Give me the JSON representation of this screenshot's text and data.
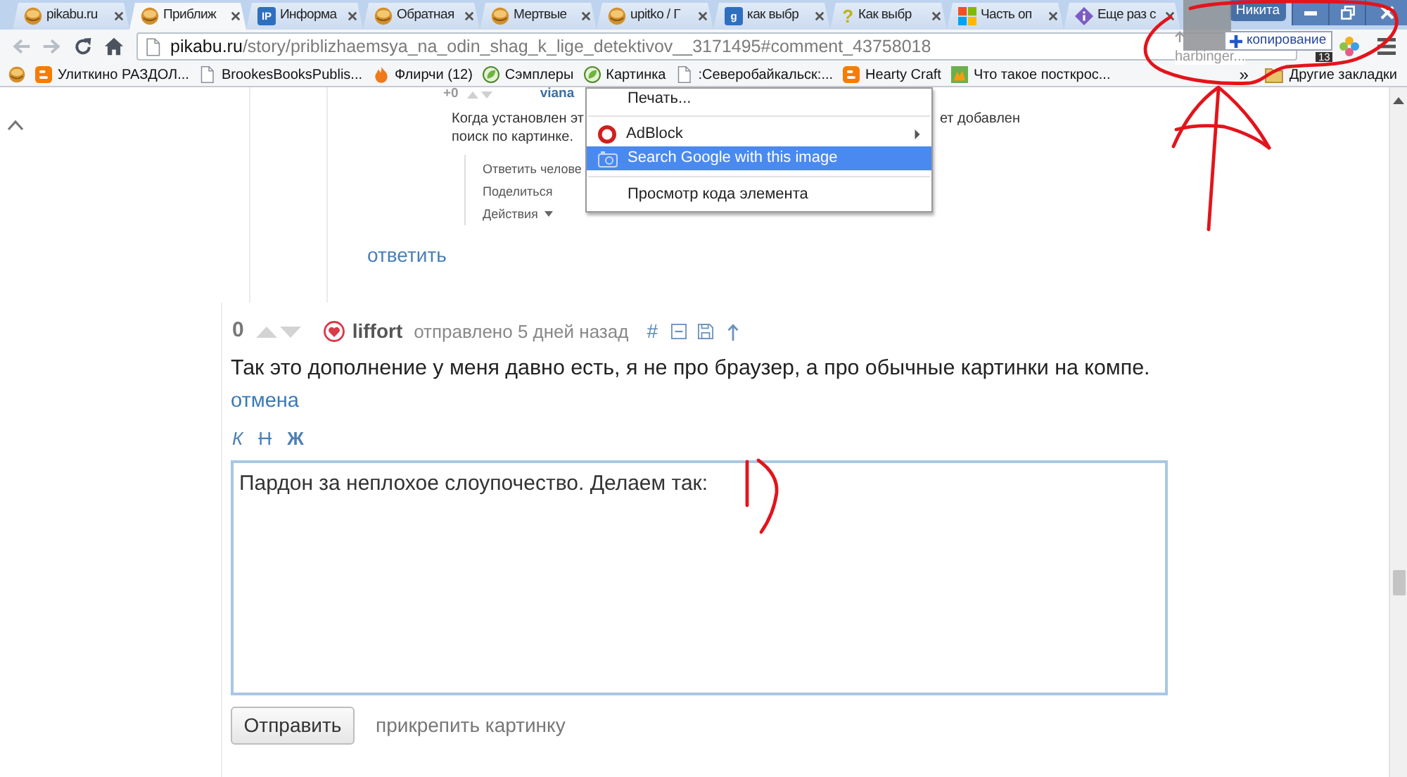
{
  "tabs": [
    {
      "title": "pikabu.ru",
      "kind": "pikabu",
      "selected": false
    },
    {
      "title": "Приближ",
      "kind": "pikabu",
      "selected": true
    },
    {
      "title": "Информа",
      "kind": "tile",
      "icon_text": "IP",
      "selected": false
    },
    {
      "title": "Обратная",
      "kind": "pikabu",
      "selected": false
    },
    {
      "title": "Мертвые",
      "kind": "pikabu",
      "selected": false
    },
    {
      "title": "upitko / Г",
      "kind": "pikabu",
      "selected": false
    },
    {
      "title": "как выбр",
      "kind": "tile",
      "icon_text": "g",
      "selected": false
    },
    {
      "title": "Как выбр",
      "kind": "glyph",
      "icon_text": "?",
      "selected": false
    },
    {
      "title": "Часть оп",
      "kind": "squares",
      "selected": false
    },
    {
      "title": "Еще раз с",
      "kind": "diamond",
      "selected": false
    }
  ],
  "profile": {
    "name": "Никита"
  },
  "toolbar": {
    "nav": [
      {
        "kind": "back",
        "disabled": true
      },
      {
        "kind": "forward",
        "disabled": true
      },
      {
        "kind": "reload",
        "disabled": false
      },
      {
        "kind": "home",
        "disabled": false
      }
    ],
    "address": {
      "host": "pikabu.ru",
      "path": "/story/priblizhaemsya_na_odin_shag_k_lige_detektivov__3171495#comment_43758018"
    },
    "extension_badge": "13"
  },
  "drag_preview": {
    "action": "копирование",
    "caption": "harbinger..."
  },
  "bookmarks": {
    "items": [
      {
        "kind": "pikabu"
      },
      {
        "label": "Улиткино РАЗДОЛ...",
        "kind": "blogger"
      },
      {
        "label": "BrookesBooksPublis...",
        "kind": "page"
      },
      {
        "label": "Флирчи (12)",
        "kind": "flame"
      },
      {
        "label": "Сэмплеры",
        "kind": "leaf"
      },
      {
        "label": "Картинка",
        "kind": "leaf"
      },
      {
        "label": ":Северобайкальск:...",
        "kind": "page"
      },
      {
        "label": "Hearty Craft",
        "kind": "blogger"
      },
      {
        "label": "Что такое посткрос...",
        "kind": "picture"
      }
    ],
    "overflow": "»",
    "other": "Другие закладки"
  },
  "page": {
    "quoted_screenshot": {
      "score": "+0",
      "author": "viana",
      "text_left": "Когда установлен эт",
      "text_right": "ет добавлен",
      "text_line_2": "поиск по картинке.",
      "actions": [
        "Ответить челове",
        "Поделиться",
        "Действия"
      ]
    },
    "context_menu": {
      "groups": [
        [
          {
            "label": "Печать...",
            "kind": "plain",
            "selected": false,
            "submenu": false
          }
        ],
        [
          {
            "label": "AdBlock",
            "kind": "adblock",
            "selected": false,
            "submenu": true
          },
          {
            "label": "Search Google with this image",
            "kind": "camera",
            "selected": true,
            "submenu": false
          }
        ],
        [
          {
            "label": "Просмотр кода элемента",
            "kind": "plain",
            "selected": false,
            "submenu": false
          }
        ]
      ]
    },
    "reply_link": "ответить",
    "comment": {
      "score": "0",
      "author": "liffort",
      "posted": "отправлено 5 дней назад",
      "anchor": "#",
      "text": "Так это дополнение у меня давно есть, я не про браузер, а про обычные картинки на компе.",
      "cancel": "отмена"
    },
    "editor": {
      "format_buttons": [
        {
          "label": "К",
          "kind": "italic"
        },
        {
          "label": "Н",
          "kind": "strike"
        },
        {
          "label": "Ж",
          "kind": "bold"
        }
      ],
      "value": "Пардон за неплохое слоупочество. Делаем так:",
      "submit": "Отправить",
      "attach": "прикрепить картинку"
    }
  }
}
